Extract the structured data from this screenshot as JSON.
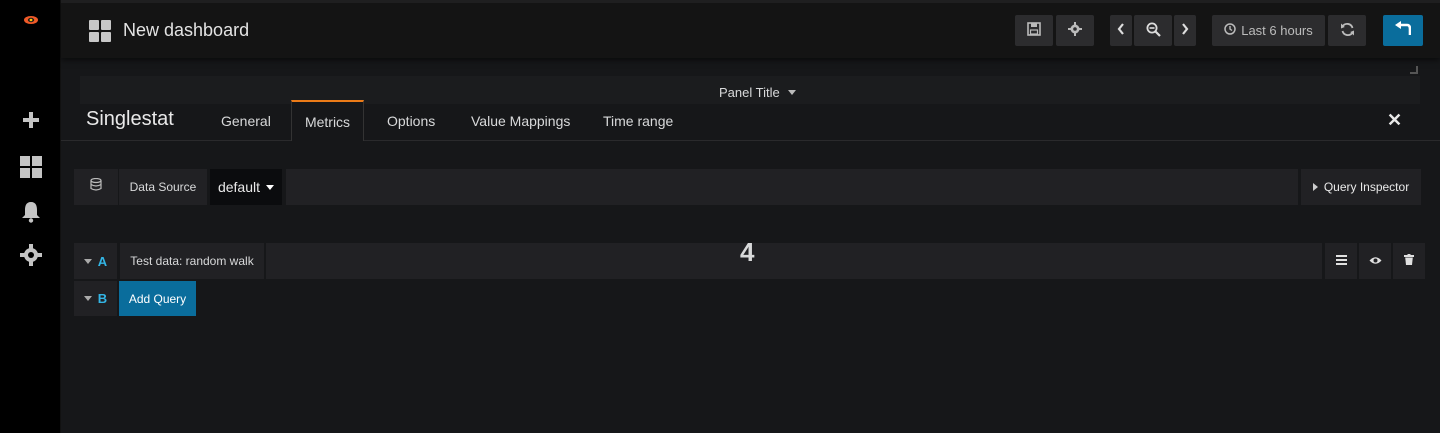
{
  "navbar": {
    "title": "New dashboard",
    "time_range": "Last 6 hours"
  },
  "panel": {
    "title": "Panel Title"
  },
  "editor": {
    "type": "Singlestat",
    "tabs": [
      "General",
      "Metrics",
      "Options",
      "Value Mappings",
      "Time range"
    ],
    "active_tab": "Metrics"
  },
  "datasource": {
    "label": "Data Source",
    "value": "default",
    "inspector_label": "Query Inspector"
  },
  "queries": [
    {
      "letter": "A",
      "name": "Test data: random walk",
      "value": "4"
    },
    {
      "letter": "B",
      "action": "Add Query"
    }
  ],
  "colors": {
    "accent": "#eb7b18",
    "primary": "#0a6d9c",
    "query_letter": "#33b5e5"
  }
}
